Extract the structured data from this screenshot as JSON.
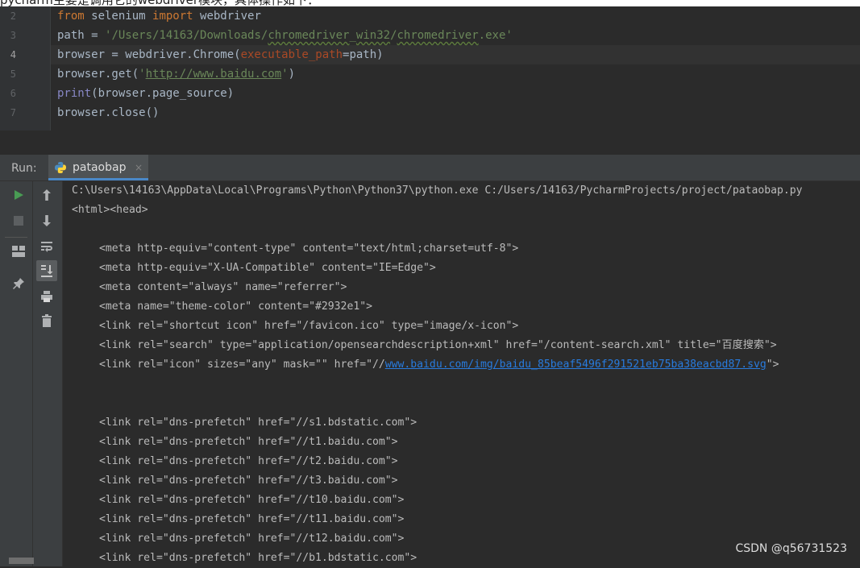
{
  "top_caption": "pycharm主要是调用它的webdriver模块，具体操作如下：",
  "editor": {
    "line_numbers": [
      "2",
      "3",
      "4",
      "5",
      "6",
      "7"
    ],
    "lines": [
      {
        "html": "<span class=\"kw\">from</span> selenium <span class=\"kw\">import</span> webdriver"
      },
      {
        "html": "path = <span class=\"str\">'/Users/14163/Downloads/<span class=\"squiggle\">chromedriver</span>_<span class=\"squiggle\">win32</span>/<span class=\"squiggle\">chromedriver</span>.exe'</span>"
      },
      {
        "html": "browser = webdriver.Chrome(<span class=\"param\">executable_path</span>=path)"
      },
      {
        "html": "browser.get(<span class=\"str\">'<span class=\"url-in-str\">http://www.baidu.com</span>'</span>)"
      },
      {
        "html": "<span class=\"builtin\">print</span>(browser.page_source)"
      },
      {
        "html": "browser.close()"
      }
    ]
  },
  "run_panel": {
    "label": "Run:",
    "tab_name": "pataobap",
    "tab_close": "×"
  },
  "toolbar_left": [
    {
      "name": "run-icon"
    },
    {
      "name": "stop-icon"
    },
    {
      "name": "layout-icon"
    },
    {
      "name": "pin-icon"
    }
  ],
  "toolbar_second": [
    {
      "name": "arrow-up-icon"
    },
    {
      "name": "arrow-down-icon"
    },
    {
      "name": "soft-wrap-icon"
    },
    {
      "name": "scroll-to-end-icon"
    },
    {
      "name": "print-icon"
    },
    {
      "name": "trash-icon"
    }
  ],
  "console": {
    "command": "C:\\Users\\14163\\AppData\\Local\\Programs\\Python\\Python37\\python.exe C:/Users/14163/PycharmProjects/project/pataobap.py",
    "lines": [
      {
        "text": "<html><head>",
        "indent": false
      },
      {
        "text": "",
        "indent": false
      },
      {
        "text": "<meta http-equiv=\"content-type\" content=\"text/html;charset=utf-8\">",
        "indent": true
      },
      {
        "text": "<meta http-equiv=\"X-UA-Compatible\" content=\"IE=Edge\">",
        "indent": true
      },
      {
        "text": "<meta content=\"always\" name=\"referrer\">",
        "indent": true
      },
      {
        "text": "<meta name=\"theme-color\" content=\"#2932e1\">",
        "indent": true
      },
      {
        "text": "<link rel=\"shortcut icon\" href=\"/favicon.ico\" type=\"image/x-icon\">",
        "indent": true
      },
      {
        "text": "<link rel=\"search\" type=\"application/opensearchdescription+xml\" href=\"/content-search.xml\" title=\"百度搜索\">",
        "indent": true
      },
      {
        "text": "<link rel=\"icon\" sizes=\"any\" mask=\"\" href=\"//",
        "link": "www.baidu.com/img/baidu_85beaf5496f291521eb75ba38eacbd87.svg",
        "after": "\">",
        "indent": true
      },
      {
        "text": "",
        "indent": false
      },
      {
        "text": "",
        "indent": false
      },
      {
        "text": "<link rel=\"dns-prefetch\" href=\"//s1.bdstatic.com\">",
        "indent": true
      },
      {
        "text": "<link rel=\"dns-prefetch\" href=\"//t1.baidu.com\">",
        "indent": true
      },
      {
        "text": "<link rel=\"dns-prefetch\" href=\"//t2.baidu.com\">",
        "indent": true
      },
      {
        "text": "<link rel=\"dns-prefetch\" href=\"//t3.baidu.com\">",
        "indent": true
      },
      {
        "text": "<link rel=\"dns-prefetch\" href=\"//t10.baidu.com\">",
        "indent": true
      },
      {
        "text": "<link rel=\"dns-prefetch\" href=\"//t11.baidu.com\">",
        "indent": true
      },
      {
        "text": "<link rel=\"dns-prefetch\" href=\"//t12.baidu.com\">",
        "indent": true
      },
      {
        "text": "<link rel=\"dns-prefetch\" href=\"//b1.bdstatic.com\">",
        "indent": true
      }
    ]
  },
  "watermark": "CSDN @q56731523",
  "colors": {
    "editor_bg": "#2b2b2b",
    "keyword": "#cc7832",
    "string": "#6a8759",
    "param": "#aa4926",
    "link": "#287bde",
    "run_green": "#499c54"
  }
}
